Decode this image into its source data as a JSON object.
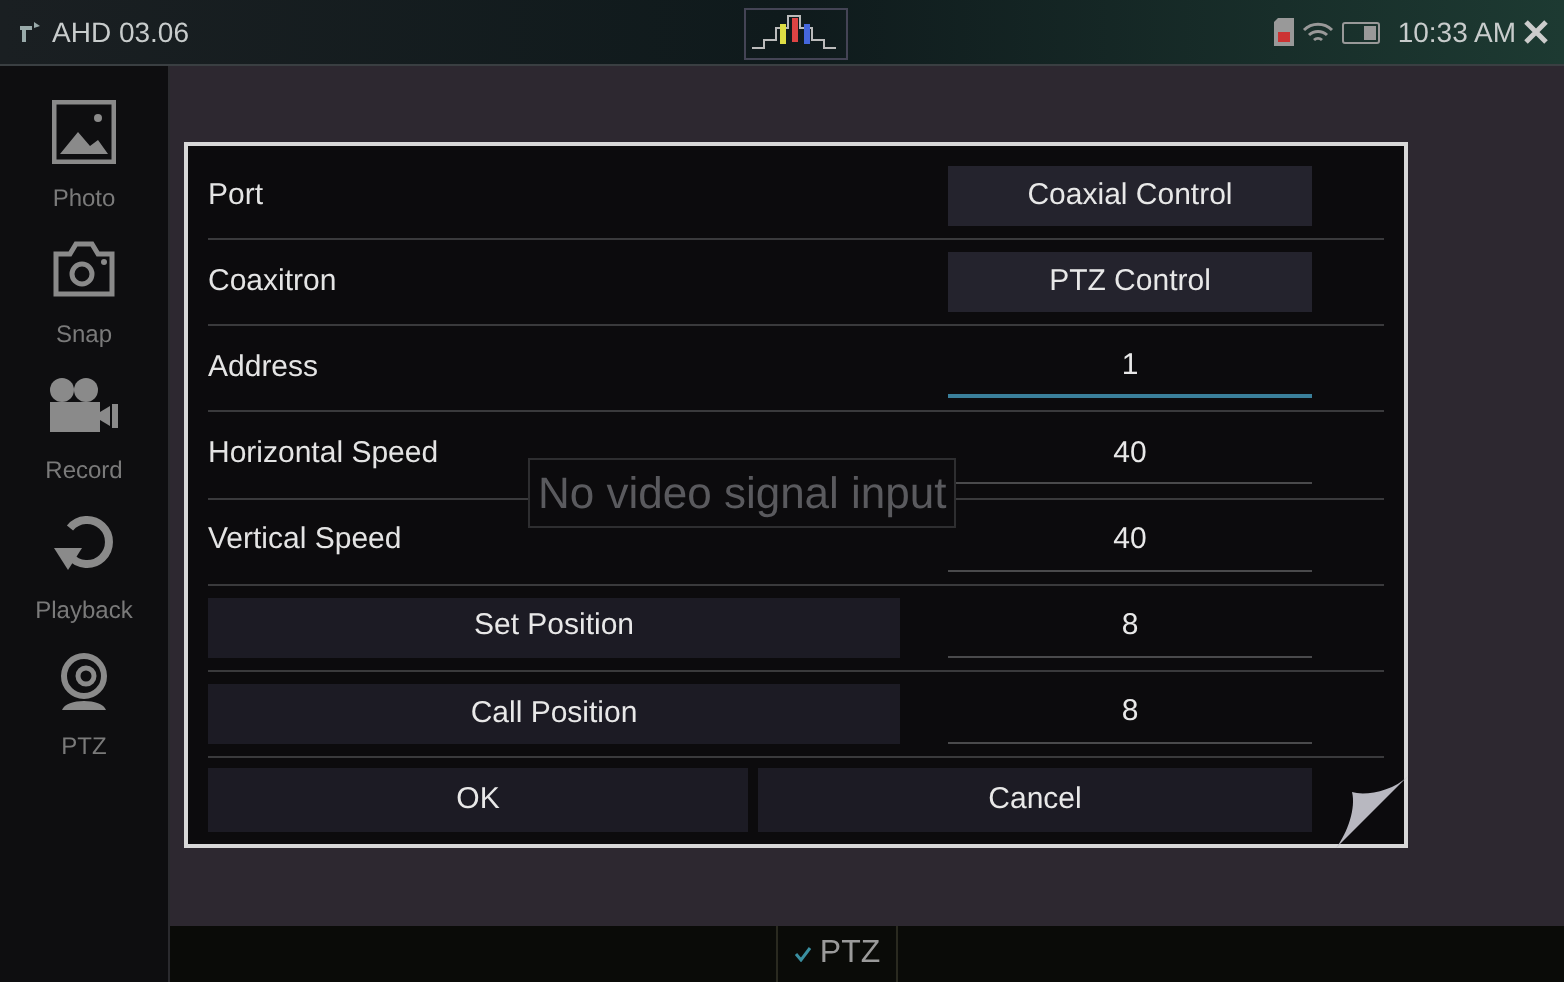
{
  "status_bar": {
    "title": "AHD 03.06",
    "time": "10:33 AM"
  },
  "sidebar": {
    "items": [
      {
        "label": "Photo",
        "kind": "photo"
      },
      {
        "label": "Snap",
        "kind": "snap"
      },
      {
        "label": "Record",
        "kind": "record"
      },
      {
        "label": "Playback",
        "kind": "playback"
      },
      {
        "label": "PTZ",
        "kind": "ptz"
      }
    ]
  },
  "video_message": "No video signal input",
  "dialog": {
    "rows": [
      {
        "kind": "select",
        "label": "Port",
        "value": "Coaxial Control"
      },
      {
        "kind": "select",
        "label": "Coaxitron",
        "value": "PTZ Control"
      },
      {
        "kind": "input",
        "label": "Address",
        "value": "1",
        "focused": true
      },
      {
        "kind": "input",
        "label": "Horizontal Speed",
        "value": "40",
        "focused": false
      },
      {
        "kind": "input",
        "label": "Vertical Speed",
        "value": "40",
        "focused": false
      },
      {
        "kind": "action",
        "label": "Set Position",
        "value": "8"
      },
      {
        "kind": "action",
        "label": "Call Position",
        "value": "8"
      }
    ],
    "buttons": [
      "OK",
      "Cancel"
    ]
  },
  "bottom_tab": {
    "label": "PTZ",
    "checked": true
  }
}
